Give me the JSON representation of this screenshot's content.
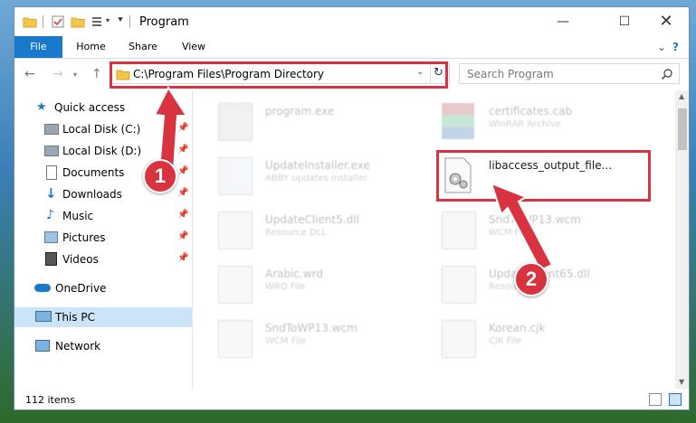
{
  "window": {
    "title": "Program"
  },
  "ribbon": {
    "tabs": [
      "File",
      "Home",
      "Share",
      "View"
    ]
  },
  "nav": {
    "address": "C:\\Program Files\\Program Directory",
    "search_placeholder": "Search Program"
  },
  "sidebar": {
    "items": [
      {
        "label": "Quick access"
      },
      {
        "label": "Local Disk (C:)"
      },
      {
        "label": "Local Disk (D:)"
      },
      {
        "label": "Documents"
      },
      {
        "label": "Downloads"
      },
      {
        "label": "Music"
      },
      {
        "label": "Pictures"
      },
      {
        "label": "Videos"
      },
      {
        "label": "OneDrive"
      },
      {
        "label": "This PC"
      },
      {
        "label": "Network"
      }
    ]
  },
  "files": [
    {
      "name": "program.exe",
      "type": ""
    },
    {
      "name": "certificates.cab",
      "type": "WinRAR Archive"
    },
    {
      "name": "UpdateInstaller.exe",
      "type": "ABBY updates installer"
    },
    {
      "name": "libaccess_output_file...",
      "type": ""
    },
    {
      "name": "UpdateClient5.dll",
      "type": "Resource DLL"
    },
    {
      "name": "SndToWP13.wcm",
      "type": "WCM File"
    },
    {
      "name": "Arabic.wrd",
      "type": "WRD File"
    },
    {
      "name": "UpdateClient65.dll",
      "type": "Resource"
    },
    {
      "name": "SndToWP13.wcm",
      "type": "WCM File"
    },
    {
      "name": "Korean.cjk",
      "type": "CJK File"
    }
  ],
  "status": {
    "item_count": "112 items"
  },
  "callouts": {
    "step1": "1",
    "step2": "2"
  },
  "colors": {
    "accent": "#1979ca",
    "highlight": "#d9333f",
    "selection": "#cce4f7"
  }
}
